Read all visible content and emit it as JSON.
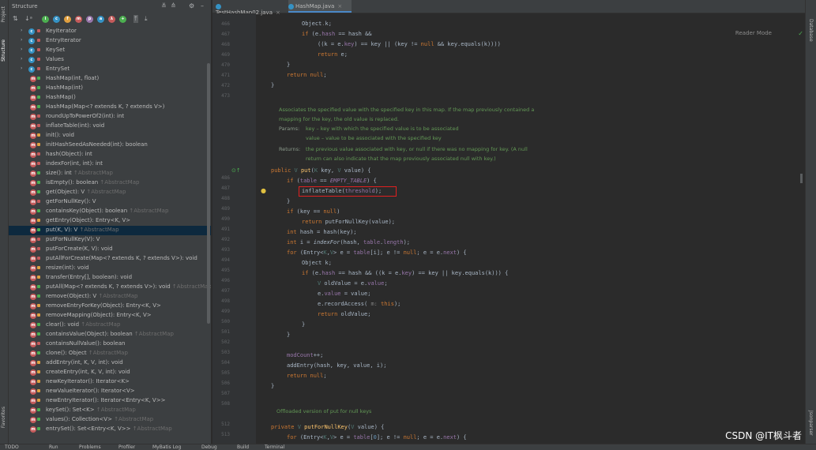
{
  "left_strip": {
    "project": "Project",
    "structure": "Structure",
    "favorites": "Favorites"
  },
  "right_strip": {
    "database": "Database",
    "jsonparser": "Jsonparser"
  },
  "structure_panel": {
    "title": "Structure",
    "items": [
      {
        "label": "KeyIterator",
        "kind": "class",
        "expand": true,
        "vis": "#c45b5b"
      },
      {
        "label": "EntryIterator",
        "kind": "class",
        "expand": true,
        "vis": "#c45b5b"
      },
      {
        "label": "KeySet",
        "kind": "class",
        "expand": true,
        "vis": "#c45b5b"
      },
      {
        "label": "Values",
        "kind": "class",
        "expand": true,
        "vis": "#c45b5b"
      },
      {
        "label": "EntrySet",
        "kind": "class",
        "expand": true,
        "vis": "#c45b5b"
      },
      {
        "label": "HashMap(int, float)",
        "kind": "method",
        "vis": "#4caf50"
      },
      {
        "label": "HashMap(int)",
        "kind": "method",
        "vis": "#4caf50"
      },
      {
        "label": "HashMap()",
        "kind": "method",
        "vis": "#4caf50"
      },
      {
        "label": "HashMap(Map<? extends K, ? extends V>)",
        "kind": "method",
        "vis": "#4caf50"
      },
      {
        "label": "roundUpToPowerOf2(int): int",
        "kind": "method",
        "vis": "#c45b5b"
      },
      {
        "label": "inflateTable(int): void",
        "kind": "method",
        "vis": "#c45b5b"
      },
      {
        "label": "init(): void",
        "kind": "method",
        "vis": "#e0a040"
      },
      {
        "label": "initHashSeedAsNeeded(int): boolean",
        "kind": "method",
        "vis": "#e0a040"
      },
      {
        "label": "hash(Object): int",
        "kind": "method",
        "vis": "#c45b5b"
      },
      {
        "label": "indexFor(int, int): int",
        "kind": "method",
        "vis": "#c45b5b"
      },
      {
        "label": "size(): int",
        "inherit": "↑AbstractMap",
        "kind": "method",
        "vis": "#4caf50"
      },
      {
        "label": "isEmpty(): boolean",
        "inherit": "↑AbstractMap",
        "kind": "method",
        "vis": "#4caf50"
      },
      {
        "label": "get(Object): V",
        "inherit": "↑AbstractMap",
        "kind": "method",
        "vis": "#4caf50"
      },
      {
        "label": "getForNullKey(): V",
        "kind": "method",
        "vis": "#c45b5b"
      },
      {
        "label": "containsKey(Object): boolean",
        "inherit": "↑AbstractMap",
        "kind": "method",
        "vis": "#4caf50"
      },
      {
        "label": "getEntry(Object): Entry<K, V>",
        "kind": "method",
        "vis": "#e0a040"
      },
      {
        "label": "put(K, V): V",
        "inherit": "↑AbstractMap",
        "kind": "method",
        "vis": "#4caf50",
        "selected": true
      },
      {
        "label": "putForNullKey(V): V",
        "kind": "method",
        "vis": "#c45b5b"
      },
      {
        "label": "putForCreate(K, V): void",
        "kind": "method",
        "vis": "#c45b5b"
      },
      {
        "label": "putAllForCreate(Map<? extends K, ? extends V>): void",
        "kind": "method",
        "vis": "#c45b5b"
      },
      {
        "label": "resize(int): void",
        "kind": "method",
        "vis": "#e0a040"
      },
      {
        "label": "transfer(Entry[], boolean): void",
        "kind": "method",
        "vis": "#e0a040"
      },
      {
        "label": "putAll(Map<? extends K, ? extends V>): void",
        "inherit": "↑AbstractMap",
        "kind": "method",
        "vis": "#4caf50"
      },
      {
        "label": "remove(Object): V",
        "inherit": "↑AbstractMap",
        "kind": "method",
        "vis": "#4caf50"
      },
      {
        "label": "removeEntryForKey(Object): Entry<K, V>",
        "kind": "method",
        "vis": "#e0a040"
      },
      {
        "label": "removeMapping(Object): Entry<K, V>",
        "kind": "method",
        "vis": "#e0a040"
      },
      {
        "label": "clear(): void",
        "inherit": "↑AbstractMap",
        "kind": "method",
        "vis": "#4caf50"
      },
      {
        "label": "containsValue(Object): boolean",
        "inherit": "↑AbstractMap",
        "kind": "method",
        "vis": "#4caf50"
      },
      {
        "label": "containsNullValue(): boolean",
        "kind": "method",
        "vis": "#c45b5b"
      },
      {
        "label": "clone(): Object",
        "inherit": "↑AbstractMap",
        "kind": "method",
        "vis": "#4caf50"
      },
      {
        "label": "addEntry(int, K, V, int): void",
        "kind": "method",
        "vis": "#e0a040"
      },
      {
        "label": "createEntry(int, K, V, int): void",
        "kind": "method",
        "vis": "#e0a040"
      },
      {
        "label": "newKeyIterator(): Iterator<K>",
        "kind": "method",
        "vis": "#e0a040"
      },
      {
        "label": "newValueIterator(): Iterator<V>",
        "kind": "method",
        "vis": "#e0a040"
      },
      {
        "label": "newEntryIterator(): Iterator<Entry<K, V>>",
        "kind": "method",
        "vis": "#e0a040"
      },
      {
        "label": "keySet(): Set<K>",
        "inherit": "↑AbstractMap",
        "kind": "method",
        "vis": "#4caf50"
      },
      {
        "label": "values(): Collection<V>",
        "inherit": "↑AbstractMap",
        "kind": "method",
        "vis": "#4caf50"
      },
      {
        "label": "entrySet(): Set<Entry<K, V>>",
        "inherit": "↑AbstractMap",
        "kind": "method",
        "vis": "#4caf50"
      }
    ]
  },
  "tabs": [
    {
      "label": "TestHashMap02.java",
      "active": false
    },
    {
      "label": "HashMap.java",
      "active": true
    }
  ],
  "editor": {
    "reader_mode": "Reader Mode",
    "line_numbers": [
      {
        "n": "466",
        "row": 0
      },
      {
        "n": "467",
        "row": 1
      },
      {
        "n": "468",
        "row": 2
      },
      {
        "n": "469",
        "row": 3
      },
      {
        "n": "470",
        "row": 4
      },
      {
        "n": "471",
        "row": 5
      },
      {
        "n": "472",
        "row": 6
      },
      {
        "n": "473",
        "row": 7
      },
      {
        "n": "486",
        "row": 15
      },
      {
        "n": "487",
        "row": 16
      },
      {
        "n": "488",
        "row": 17
      },
      {
        "n": "489",
        "row": 18
      },
      {
        "n": "490",
        "row": 19
      },
      {
        "n": "491",
        "row": 20
      },
      {
        "n": "492",
        "row": 21
      },
      {
        "n": "493",
        "row": 22
      },
      {
        "n": "494",
        "row": 23
      },
      {
        "n": "495",
        "row": 24
      },
      {
        "n": "496",
        "row": 25
      },
      {
        "n": "497",
        "row": 26
      },
      {
        "n": "498",
        "row": 27
      },
      {
        "n": "499",
        "row": 28
      },
      {
        "n": "500",
        "row": 29
      },
      {
        "n": "501",
        "row": 30
      },
      {
        "n": "502",
        "row": 31
      },
      {
        "n": "503",
        "row": 32
      },
      {
        "n": "504",
        "row": 33
      },
      {
        "n": "505",
        "row": 34
      },
      {
        "n": "506",
        "row": 35
      },
      {
        "n": "507",
        "row": 36
      },
      {
        "n": "508",
        "row": 37
      },
      {
        "n": "512",
        "row": 39
      },
      {
        "n": "513",
        "row": 40
      }
    ],
    "doc": {
      "line1": "Associates the specified value with the specified key in this map. If the map previously contained a",
      "line2": "mapping for the key, the old value is replaced.",
      "params_tag": "Params:",
      "param1": "key – key with which the specified value is to be associated",
      "param2": "value – value to be associated with the specified key",
      "returns_tag": "Returns:",
      "ret1": "the previous value associated with key, or null if there was no mapping for key. (A null",
      "ret2": "return can also indicate that the map previously associated null with key.)"
    },
    "doc2": "Offloaded version of put for null keys",
    "highlight_label": "inflateTable(threshold);"
  },
  "bottom_bar": {
    "items": [
      "TODO",
      "Run",
      "Problems",
      "Profiler",
      "MyBatis Log",
      "Debug",
      "Build",
      "Terminal"
    ]
  },
  "watermark": "CSDN @IT枫斗者"
}
